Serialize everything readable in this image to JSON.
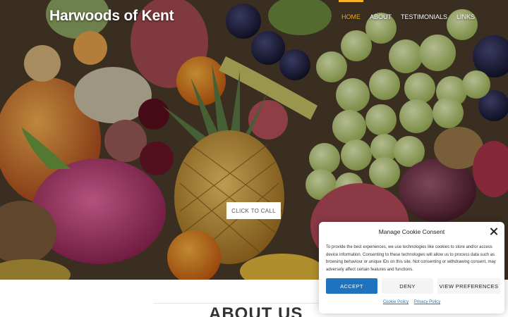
{
  "site": {
    "title": "Harwoods of Kent"
  },
  "nav": {
    "items": [
      {
        "label": "HOME",
        "active": true
      },
      {
        "label": "ABOUT",
        "active": false
      },
      {
        "label": "TESTIMONIALS",
        "active": false
      },
      {
        "label": "LINKS",
        "active": false
      }
    ],
    "accent_color": "#f3b229"
  },
  "hero": {
    "cta_label": "CLICK TO CALL"
  },
  "about": {
    "heading": "ABOUT US"
  },
  "cookie": {
    "title": "Manage Cookie Consent",
    "body": "To provide the best experiences, we use technologies like cookies to store and/or access device information. Consenting to these technologies will allow us to process data such as browsing behaviour or unique IDs on this site. Not consenting or withdrawing consent, may adversely affect certain features and functions.",
    "accept_label": "ACCEPT",
    "deny_label": "DENY",
    "preferences_label": "VIEW PREFERENCES",
    "links": [
      {
        "label": "Cookie Policy"
      },
      {
        "label": "Privacy Policy"
      }
    ],
    "accent_color": "#1e73be"
  }
}
